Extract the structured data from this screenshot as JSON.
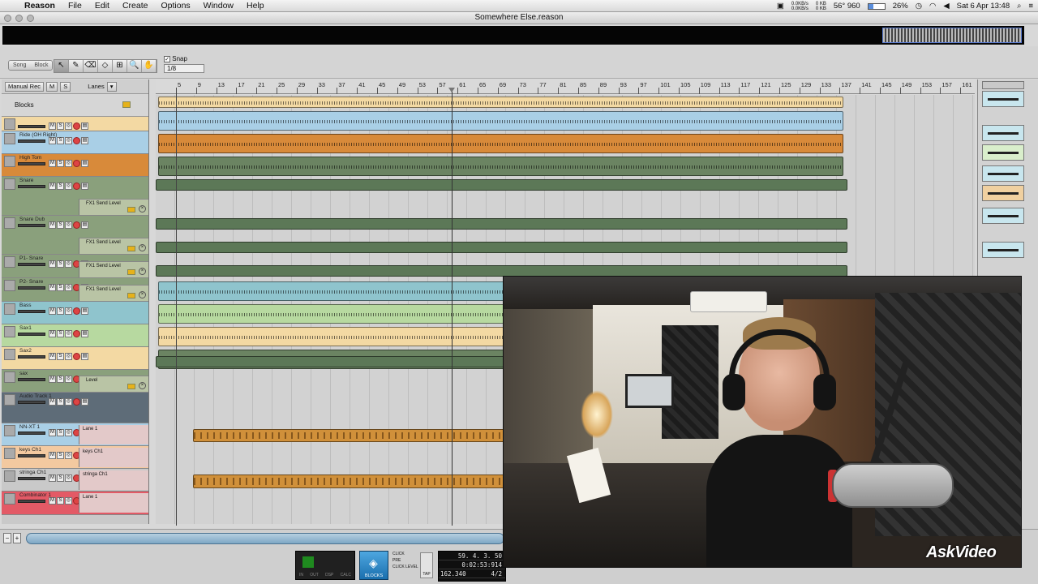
{
  "menubar": {
    "app_name": "Reason",
    "items": [
      "File",
      "Edit",
      "Create",
      "Options",
      "Window",
      "Help"
    ],
    "status": {
      "net_up": "0.0KB/s",
      "net_down": "0.0KB/s",
      "disk_r": "0 KB",
      "disk_w": "0 KB",
      "temp": "56° 960",
      "battery": "26%",
      "clock": "Sat 6 Apr  13:48"
    }
  },
  "window": {
    "title": "Somewhere Else.reason"
  },
  "toolbar": {
    "song_label": "Song",
    "block_label": "Block",
    "tools": [
      "↖",
      "✎",
      "⌫",
      "◇",
      "⊞",
      "🔍",
      "✋"
    ],
    "snap_label": "Snap",
    "snap_checked": "✓",
    "snap_value": "1/8"
  },
  "lane_header": {
    "manual_rec": "Manual Rec",
    "m": "M",
    "s": "S",
    "lanes": "Lanes",
    "blocks": "Blocks"
  },
  "ruler": [
    "5",
    "9",
    "13",
    "17",
    "21",
    "25",
    "29",
    "33",
    "37",
    "41",
    "45",
    "49",
    "53",
    "57",
    "61",
    "65",
    "69",
    "73",
    "77",
    "81",
    "85",
    "89",
    "93",
    "97",
    "101",
    "105",
    "109",
    "113",
    "117",
    "121",
    "125",
    "129",
    "133",
    "137",
    "141",
    "145",
    "149",
    "153",
    "157",
    "161"
  ],
  "tracks": [
    {
      "name": "",
      "color": "#f3d9a3"
    },
    {
      "name": "Ride (OH Right)",
      "color": "#a9cfe6"
    },
    {
      "name": "High Tom",
      "color": "#d88a3a"
    },
    {
      "name": "Snare",
      "color": "#8aa07c"
    },
    {
      "name": "Snare Dub",
      "color": "#8aa07c"
    },
    {
      "name": "P1- Snare",
      "color": "#8aa07c"
    },
    {
      "name": "P2- Snare",
      "color": "#8aa07c"
    },
    {
      "name": "Bass",
      "color": "#8fc4cd"
    },
    {
      "name": "Sax1",
      "color": "#b7d9a0"
    },
    {
      "name": "Sax2",
      "color": "#f3d9a3"
    },
    {
      "name": "sax",
      "color": "#8aa07c"
    },
    {
      "name": "Audio Track 1",
      "color": "#5e6c78"
    },
    {
      "name": "NN-XT 1",
      "color": "#a9cfe6"
    },
    {
      "name": "keys Ch1",
      "color": "#f3c9a0"
    },
    {
      "name": "stringa Ch1",
      "color": "#c9c9c9"
    },
    {
      "name": "Combinator 1",
      "color": "#e35a66"
    }
  ],
  "automation_labels": {
    "fx1": "FX1 Send Level",
    "level": "Level",
    "lane1": "Lane 1",
    "keys_lane": "keys Ch1",
    "strings_lane": "stringa Ch1"
  },
  "transport": {
    "position": "59.  4.  3.  50",
    "time": "0:02:53:914",
    "tempo": "162.340",
    "signature": "4/2",
    "blocks_label": "BLOCKS",
    "click": "CLICK",
    "pre": "PRE",
    "click_level": "CLICK LEVEL",
    "tap": "TAP",
    "meter_labels": [
      "IN",
      "OUT",
      "DSP",
      "CALC"
    ]
  },
  "watermark": "AskVideo"
}
